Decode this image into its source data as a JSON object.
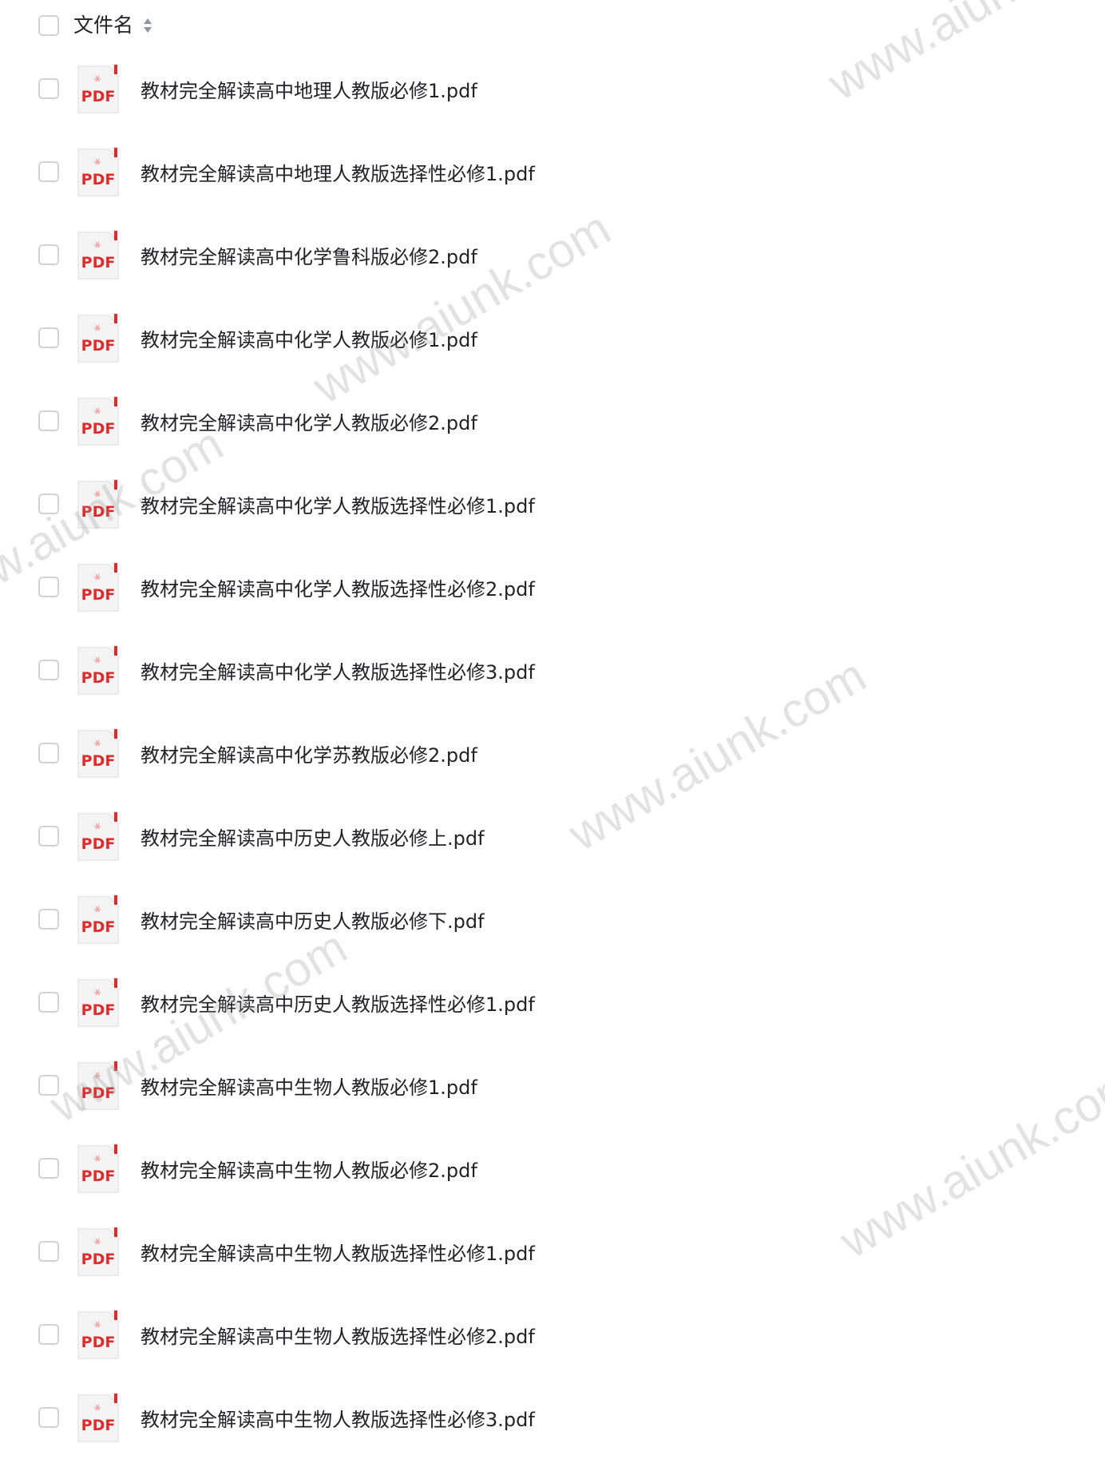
{
  "header": {
    "column_label": "文件名",
    "sort_icon": "sort-icon"
  },
  "file_icon": "pdf-file-icon",
  "pdf_badge": "PDF",
  "files": [
    {
      "name": "教材完全解读高中地理人教版必修1.pdf"
    },
    {
      "name": "教材完全解读高中地理人教版选择性必修1.pdf"
    },
    {
      "name": "教材完全解读高中化学鲁科版必修2.pdf"
    },
    {
      "name": "教材完全解读高中化学人教版必修1.pdf"
    },
    {
      "name": "教材完全解读高中化学人教版必修2.pdf"
    },
    {
      "name": "教材完全解读高中化学人教版选择性必修1.pdf"
    },
    {
      "name": "教材完全解读高中化学人教版选择性必修2.pdf"
    },
    {
      "name": "教材完全解读高中化学人教版选择性必修3.pdf"
    },
    {
      "name": "教材完全解读高中化学苏教版必修2.pdf"
    },
    {
      "name": "教材完全解读高中历史人教版必修上.pdf"
    },
    {
      "name": "教材完全解读高中历史人教版必修下.pdf"
    },
    {
      "name": "教材完全解读高中历史人教版选择性必修1.pdf"
    },
    {
      "name": "教材完全解读高中生物人教版必修1.pdf"
    },
    {
      "name": "教材完全解读高中生物人教版必修2.pdf"
    },
    {
      "name": "教材完全解读高中生物人教版选择性必修1.pdf"
    },
    {
      "name": "教材完全解读高中生物人教版选择性必修2.pdf"
    },
    {
      "name": "教材完全解读高中生物人教版选择性必修3.pdf"
    }
  ],
  "watermark_text": "www.aiunk.com",
  "colors": {
    "pdf_red": "#e02b2b",
    "text": "#1f2329",
    "checkbox_border": "#d0d3d6"
  }
}
